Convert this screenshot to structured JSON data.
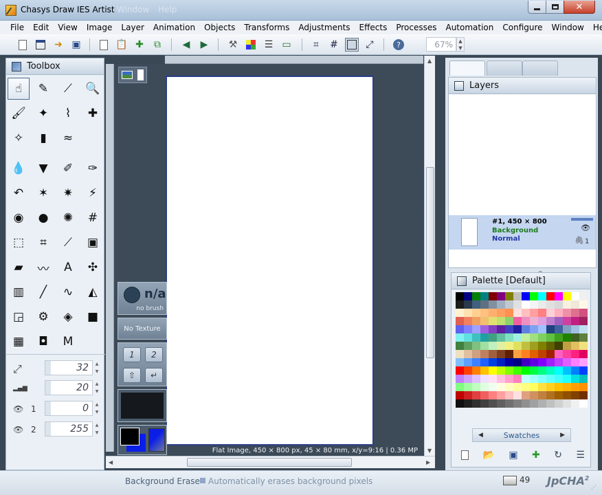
{
  "window": {
    "title": "Chasys Draw IES Artist",
    "ghost_items": [
      "Window",
      "Help"
    ],
    "close_glyph": "✕"
  },
  "menu": [
    "File",
    "Edit",
    "View",
    "Image",
    "Layer",
    "Animation",
    "Objects",
    "Transforms",
    "Adjustments",
    "Effects",
    "Processes",
    "Automation",
    "Configure",
    "Window",
    "Help"
  ],
  "toolbar": {
    "zoom": "67%"
  },
  "toolbox": {
    "title": "Toolbox",
    "tools": [
      {
        "name": "hand-tool",
        "glyph": "☝"
      },
      {
        "name": "pencil-tool",
        "glyph": "✎"
      },
      {
        "name": "eyedropper-tool",
        "glyph": "⟋"
      },
      {
        "name": "zoom-tool",
        "glyph": "🔍"
      },
      {
        "name": "brush-tool",
        "glyph": "🖌"
      },
      {
        "name": "fx-brush-tool",
        "glyph": "✦"
      },
      {
        "name": "smudge-tool",
        "glyph": "⌇"
      },
      {
        "name": "clone-tool",
        "glyph": "✚"
      },
      {
        "name": "airbrush-tool",
        "glyph": "✧"
      },
      {
        "name": "spray-tool",
        "glyph": "▮"
      },
      {
        "name": "wave-tool",
        "glyph": "≈"
      },
      {
        "name": "drop-tool",
        "glyph": "💧"
      },
      {
        "name": "triangle-tool",
        "glyph": "▼"
      },
      {
        "name": "pen-tool",
        "glyph": "✐"
      },
      {
        "name": "blue-pen-tool",
        "glyph": "✑"
      },
      {
        "name": "curve-tool",
        "glyph": "↶"
      },
      {
        "name": "magic-fill-tool",
        "glyph": "✶"
      },
      {
        "name": "recolor-tool",
        "glyph": "✷"
      },
      {
        "name": "wand-tool",
        "glyph": "⚡"
      },
      {
        "name": "sphere-tool",
        "glyph": "◉"
      },
      {
        "name": "orb-tool",
        "glyph": "●"
      },
      {
        "name": "splatter-tool",
        "glyph": "✺"
      },
      {
        "name": "grid-tool",
        "glyph": "#"
      },
      {
        "name": "selection-tool",
        "glyph": "⬚"
      },
      {
        "name": "crop-tool",
        "glyph": "⌗"
      },
      {
        "name": "dropper-tool",
        "glyph": "⟋"
      },
      {
        "name": "select-rect-tool",
        "glyph": "▣"
      },
      {
        "name": "eraser-tool",
        "glyph": "▰"
      },
      {
        "name": "freehand-tool",
        "glyph": "〰"
      },
      {
        "name": "text-tool",
        "glyph": "A"
      },
      {
        "name": "path-tool",
        "glyph": "✣"
      },
      {
        "name": "chart-tool",
        "glyph": "▥"
      },
      {
        "name": "line-tool",
        "glyph": "╱"
      },
      {
        "name": "spline-tool",
        "glyph": "∿"
      },
      {
        "name": "shapes-tool",
        "glyph": "◭"
      },
      {
        "name": "frame-tool",
        "glyph": "◲"
      },
      {
        "name": "gear-tool",
        "glyph": "⚙"
      },
      {
        "name": "gradient-tool",
        "glyph": "◈"
      },
      {
        "name": "cube-tool",
        "glyph": "■"
      },
      {
        "name": "color-grid-tool",
        "glyph": "▦"
      },
      {
        "name": "texture-tool",
        "glyph": "◘"
      },
      {
        "name": "macro-tool",
        "glyph": "M"
      }
    ],
    "params": [
      {
        "name": "size",
        "icon": "⤢",
        "label": "",
        "value": "32"
      },
      {
        "name": "hardness",
        "icon": "▂▄▆",
        "label": "",
        "value": "20"
      },
      {
        "name": "opacity-1",
        "icon": "👁",
        "label": "1",
        "value": "0"
      },
      {
        "name": "opacity-2",
        "icon": "👁",
        "label": "2",
        "value": "255"
      }
    ]
  },
  "brush_panel": {
    "brush_name": "n/a",
    "brush_sub": "no brush",
    "texture": "No Texture",
    "key1": "1",
    "key2": "2",
    "key_shift": "⇧",
    "key_enter": "↵"
  },
  "canvas": {
    "status": "Flat Image, 450 × 800 px, 45 × 80 mm, x/y=9:16 | 0.36 MP"
  },
  "layers": {
    "title": "Layers",
    "layer_name": "#1, 450 × 800",
    "layer_sub": "Background",
    "layer_mode": "Normal",
    "layer_count": "1"
  },
  "palette": {
    "title": "Palette [Default]",
    "swatch_label": "Swatches",
    "colors": [
      "#000000",
      "#000080",
      "#008000",
      "#008080",
      "#800000",
      "#800080",
      "#808000",
      "#c0c0c0",
      "#0000ff",
      "#00ff00",
      "#00ffff",
      "#ff0000",
      "#ff00ff",
      "#ffff00",
      "#ffffff",
      "#f0f0f0",
      "#1c1c1c",
      "#2a3a4a",
      "#406080",
      "#607080",
      "#8090a0",
      "#a0b0c0",
      "#c0c8d0",
      "#e0e0e0",
      "#ffffff",
      "#f4f4f4",
      "#eaeaea",
      "#e0e0e0",
      "#d8d8d8",
      "#f8f0e0",
      "#f0e8d8",
      "#fff8e8",
      "#fff0d0",
      "#ffe0b0",
      "#ffd090",
      "#ffc080",
      "#ffb070",
      "#ffa060",
      "#ff9050",
      "#ffe0e0",
      "#ffc0c0",
      "#ffa0a0",
      "#ff8080",
      "#ffd0d8",
      "#ffb0c0",
      "#f090a8",
      "#e07090",
      "#d05080",
      "#e06050",
      "#f08060",
      "#f0a060",
      "#f0c070",
      "#e0e070",
      "#c0e070",
      "#90d070",
      "#f060a0",
      "#f090c0",
      "#f0b0d0",
      "#e0a0e0",
      "#c080d0",
      "#a060c0",
      "#d040a0",
      "#c02080",
      "#a02060",
      "#6060f0",
      "#8080ff",
      "#a0a0ff",
      "#a060e0",
      "#8040c0",
      "#6020a0",
      "#4040c0",
      "#2020a0",
      "#6080e0",
      "#80a0f0",
      "#a0c0ff",
      "#204080",
      "#4060a0",
      "#80a0c0",
      "#a0c0e0",
      "#c0e0f0",
      "#80f0f0",
      "#60e0e0",
      "#40c0c0",
      "#20a0a0",
      "#40a080",
      "#60c0a0",
      "#80e0c0",
      "#a0f0e0",
      "#c0f0a0",
      "#a0e080",
      "#80d060",
      "#60c040",
      "#40a020",
      "#208000",
      "#406020",
      "#608040",
      "#408040",
      "#60a060",
      "#80c080",
      "#a0e0a0",
      "#c0f0c0",
      "#e0f0a0",
      "#f0f080",
      "#e0e060",
      "#c0c040",
      "#a0a020",
      "#808000",
      "#606000",
      "#404000",
      "#c0a040",
      "#e0c060",
      "#f0e080",
      "#f0e0c0",
      "#e0c0a0",
      "#d0a080",
      "#c08060",
      "#a06040",
      "#804020",
      "#602000",
      "#ffa040",
      "#ff8020",
      "#e06000",
      "#c04000",
      "#a02000",
      "#ff60c0",
      "#ff40a0",
      "#ff2080",
      "#e00060",
      "#80c0ff",
      "#60a0ff",
      "#4080ff",
      "#2060ff",
      "#0040e0",
      "#0020c0",
      "#0000a0",
      "#000080",
      "#4000c0",
      "#6000e0",
      "#8000ff",
      "#a020ff",
      "#c040ff",
      "#e060ff",
      "#ff80ff",
      "#ffa0ff",
      "#ff0000",
      "#ff4000",
      "#ff8000",
      "#ffc000",
      "#ffff00",
      "#c0ff00",
      "#80ff00",
      "#40ff00",
      "#00ff00",
      "#00ff40",
      "#00ff80",
      "#00ffc0",
      "#00ffff",
      "#00c0ff",
      "#0080ff",
      "#0040ff",
      "#c080ff",
      "#d0a0ff",
      "#e0c0ff",
      "#f0e0ff",
      "#ffe0f0",
      "#ffc0e0",
      "#ffa0d0",
      "#ff80c0",
      "#c0ffff",
      "#a0ffff",
      "#80ffff",
      "#60ffff",
      "#40ffff",
      "#20ffff",
      "#00e0e0",
      "#00c0c0",
      "#80ff80",
      "#a0ffa0",
      "#c0ffc0",
      "#e0ffe0",
      "#f0fff0",
      "#ffffe0",
      "#ffffc0",
      "#ffffa0",
      "#ffff80",
      "#ffff60",
      "#ffe040",
      "#ffd020",
      "#ffc000",
      "#ffb000",
      "#ffa000",
      "#ff9000",
      "#c00000",
      "#d02020",
      "#e04040",
      "#f06060",
      "#ff8080",
      "#ffa0a0",
      "#ffc0c0",
      "#ffe0e0",
      "#e0a080",
      "#d09060",
      "#c08040",
      "#b07020",
      "#a06000",
      "#905000",
      "#804000",
      "#703000",
      "#101010",
      "#202020",
      "#303030",
      "#404040",
      "#505050",
      "#606060",
      "#707070",
      "#808080",
      "#909090",
      "#a0a0a0",
      "#b0b0b0",
      "#c0c0c0",
      "#d0d0d0",
      "#e0e0e0",
      "#f0f0f0",
      "#ffffff"
    ]
  },
  "status": {
    "tool": "Background Erase",
    "description": "Automatically erases background pixels",
    "jobs": "49",
    "brand": "JpCHA",
    "brand_sup": "2"
  }
}
